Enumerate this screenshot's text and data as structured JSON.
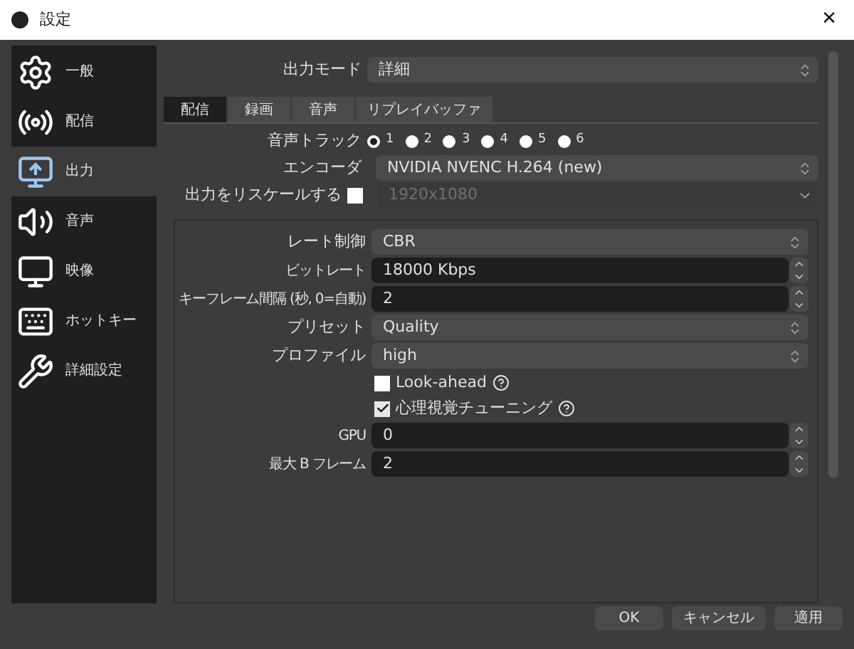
{
  "window": {
    "title": "設定",
    "close": "✕"
  },
  "sidebar": {
    "items": [
      {
        "label": "一般",
        "selected": false
      },
      {
        "label": "配信",
        "selected": false
      },
      {
        "label": "出力",
        "selected": true
      },
      {
        "label": "音声",
        "selected": false
      },
      {
        "label": "映像",
        "selected": false
      },
      {
        "label": "ホットキー",
        "selected": false
      },
      {
        "label": "詳細設定",
        "selected": false
      }
    ]
  },
  "output_mode": {
    "label": "出力モード",
    "value": "詳細"
  },
  "tabs": [
    {
      "label": "配信",
      "selected": true
    },
    {
      "label": "録画",
      "selected": false
    },
    {
      "label": "音声",
      "selected": false
    },
    {
      "label": "リプレイバッファ",
      "selected": false
    }
  ],
  "audio_track": {
    "label": "音声トラック",
    "options": [
      {
        "label": "1",
        "selected": true
      },
      {
        "label": "2",
        "selected": false
      },
      {
        "label": "3",
        "selected": false
      },
      {
        "label": "4",
        "selected": false
      },
      {
        "label": "5",
        "selected": false
      },
      {
        "label": "6",
        "selected": false
      }
    ]
  },
  "encoder": {
    "label": "エンコーダ",
    "value": "NVIDIA NVENC H.264 (new)"
  },
  "rescale": {
    "label": "出力をリスケールする",
    "checked": false,
    "value": "1920x1080"
  },
  "settings": [
    {
      "kind": "select",
      "label": "レート制御",
      "value": "CBR"
    },
    {
      "kind": "spin",
      "label": "ビットレート",
      "value": "18000 Kbps"
    },
    {
      "kind": "spin",
      "label": "キーフレーム間隔 (秒, 0=自動)",
      "value": "2"
    },
    {
      "kind": "select",
      "label": "プリセット",
      "value": "Quality"
    },
    {
      "kind": "select",
      "label": "プロファイル",
      "value": "high"
    },
    {
      "kind": "checkbox",
      "label": "Look-ahead",
      "checked": false
    },
    {
      "kind": "checkbox",
      "label": "心理視覚チューニング",
      "checked": true
    },
    {
      "kind": "spin",
      "label": "GPU",
      "value": "0"
    },
    {
      "kind": "spin",
      "label": "最大 B フレーム",
      "value": "2"
    }
  ],
  "buttons": [
    "OK",
    "キャンセル",
    "適用"
  ]
}
